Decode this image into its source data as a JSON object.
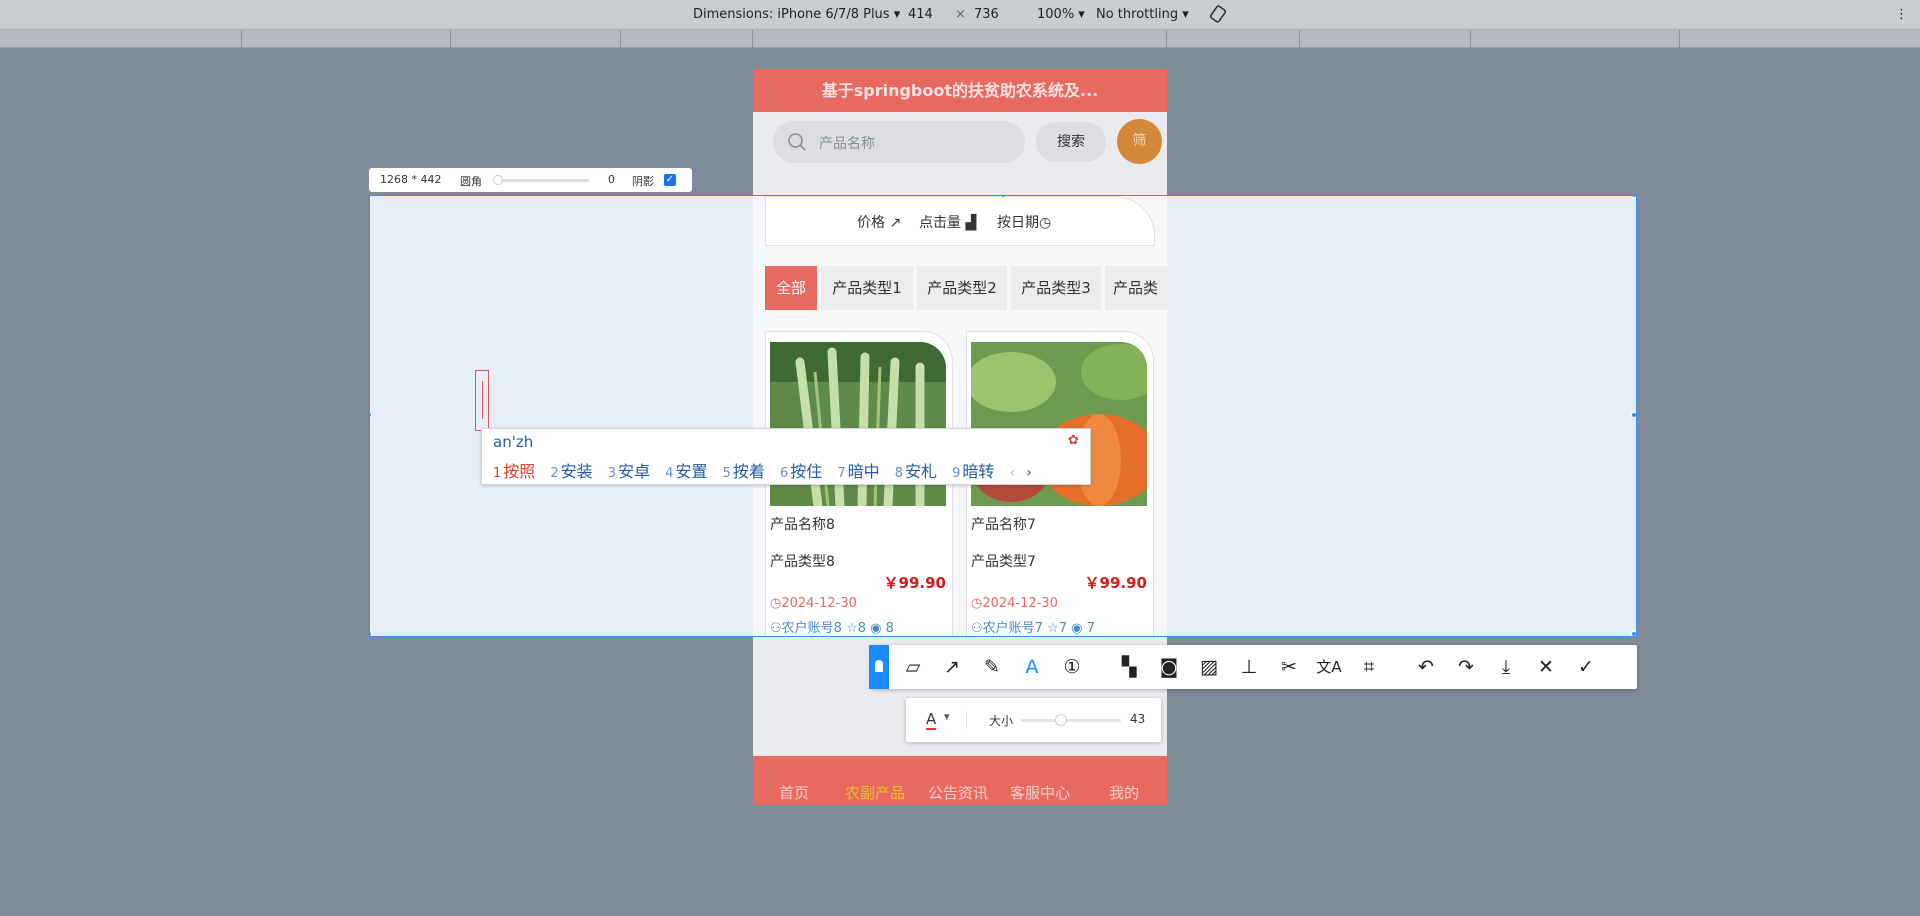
{
  "devtools": {
    "dimensions_label": "Dimensions: iPhone 6/7/8 Plus",
    "width": "414",
    "times": "×",
    "height": "736",
    "zoom": "100%",
    "throttle": "No throttling",
    "more": "⋮"
  },
  "app": {
    "title": "基于springboot的扶贫助农系统及...",
    "search_placeholder": "产品名称",
    "search_button": "搜索",
    "filter_button": "筛",
    "sort": [
      "价格",
      "点击量",
      "按日期"
    ],
    "tabs": [
      "全部",
      "产品类型1",
      "产品类型2",
      "产品类型3",
      "产品类"
    ],
    "cards": [
      {
        "name": "产品名称8",
        "type": "产品类型8",
        "price": "￥99.90",
        "date": "2024-12-30",
        "farmer": "农户账号8",
        "stars": "8",
        "views": "8"
      },
      {
        "name": "产品名称7",
        "type": "产品类型7",
        "price": "￥99.90",
        "date": "2024-12-30",
        "farmer": "农户账号7",
        "stars": "7",
        "views": "7"
      }
    ],
    "nav": [
      "首页",
      "农副产品",
      "公告资讯",
      "客服中心",
      "我的"
    ]
  },
  "capture": {
    "size_label": "1268 * 442",
    "radius_label": "圆角",
    "radius_value": "0",
    "shadow_label": "阴影",
    "shadow_checked": true
  },
  "ime": {
    "pinyin": "an'zh",
    "candidates": [
      {
        "n": "1",
        "t": "按照"
      },
      {
        "n": "2",
        "t": "安装"
      },
      {
        "n": "3",
        "t": "安卓"
      },
      {
        "n": "4",
        "t": "安置"
      },
      {
        "n": "5",
        "t": "按着"
      },
      {
        "n": "6",
        "t": "按住"
      },
      {
        "n": "7",
        "t": "暗中"
      },
      {
        "n": "8",
        "t": "安札"
      },
      {
        "n": "9",
        "t": "暗转"
      }
    ]
  },
  "toolbar": {
    "size_label": "大小",
    "size_value": "43",
    "font_icon": "A",
    "number_icon": "①"
  },
  "colors": {
    "accent": "#e8695f",
    "selection": "#3b8eea",
    "price": "#d61a1a"
  }
}
